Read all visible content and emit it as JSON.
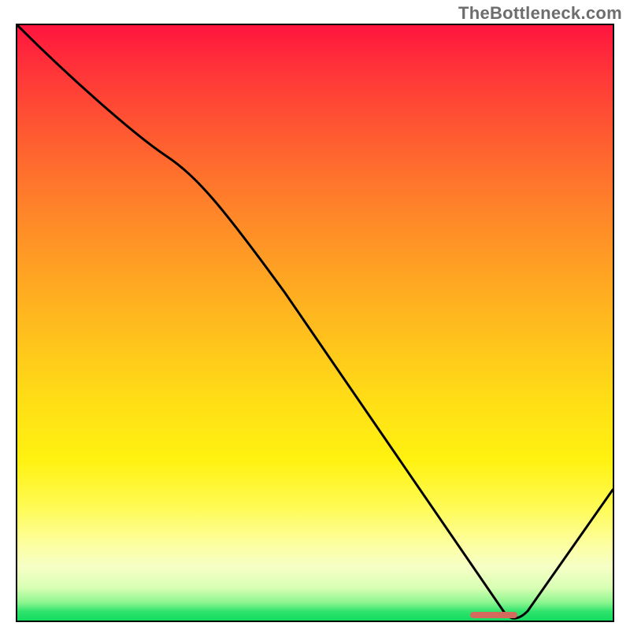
{
  "watermark": "TheBottleneck.com",
  "chart_data": {
    "type": "line",
    "title": "",
    "xlabel": "",
    "ylabel": "",
    "xlim": [
      0,
      100
    ],
    "ylim": [
      0,
      100
    ],
    "x": [
      0,
      25,
      82,
      100
    ],
    "values": [
      100,
      78,
      0,
      22
    ],
    "optimal_marker_x": 80,
    "notes": "Gradient background from red (top) through orange/yellow to green (bottom). Black curve: steep initial descent, near-linear middle drop to trough at x≈82 y≈0, then rises to y≈22 at right edge. Small red rounded marker on x-axis near trough."
  }
}
